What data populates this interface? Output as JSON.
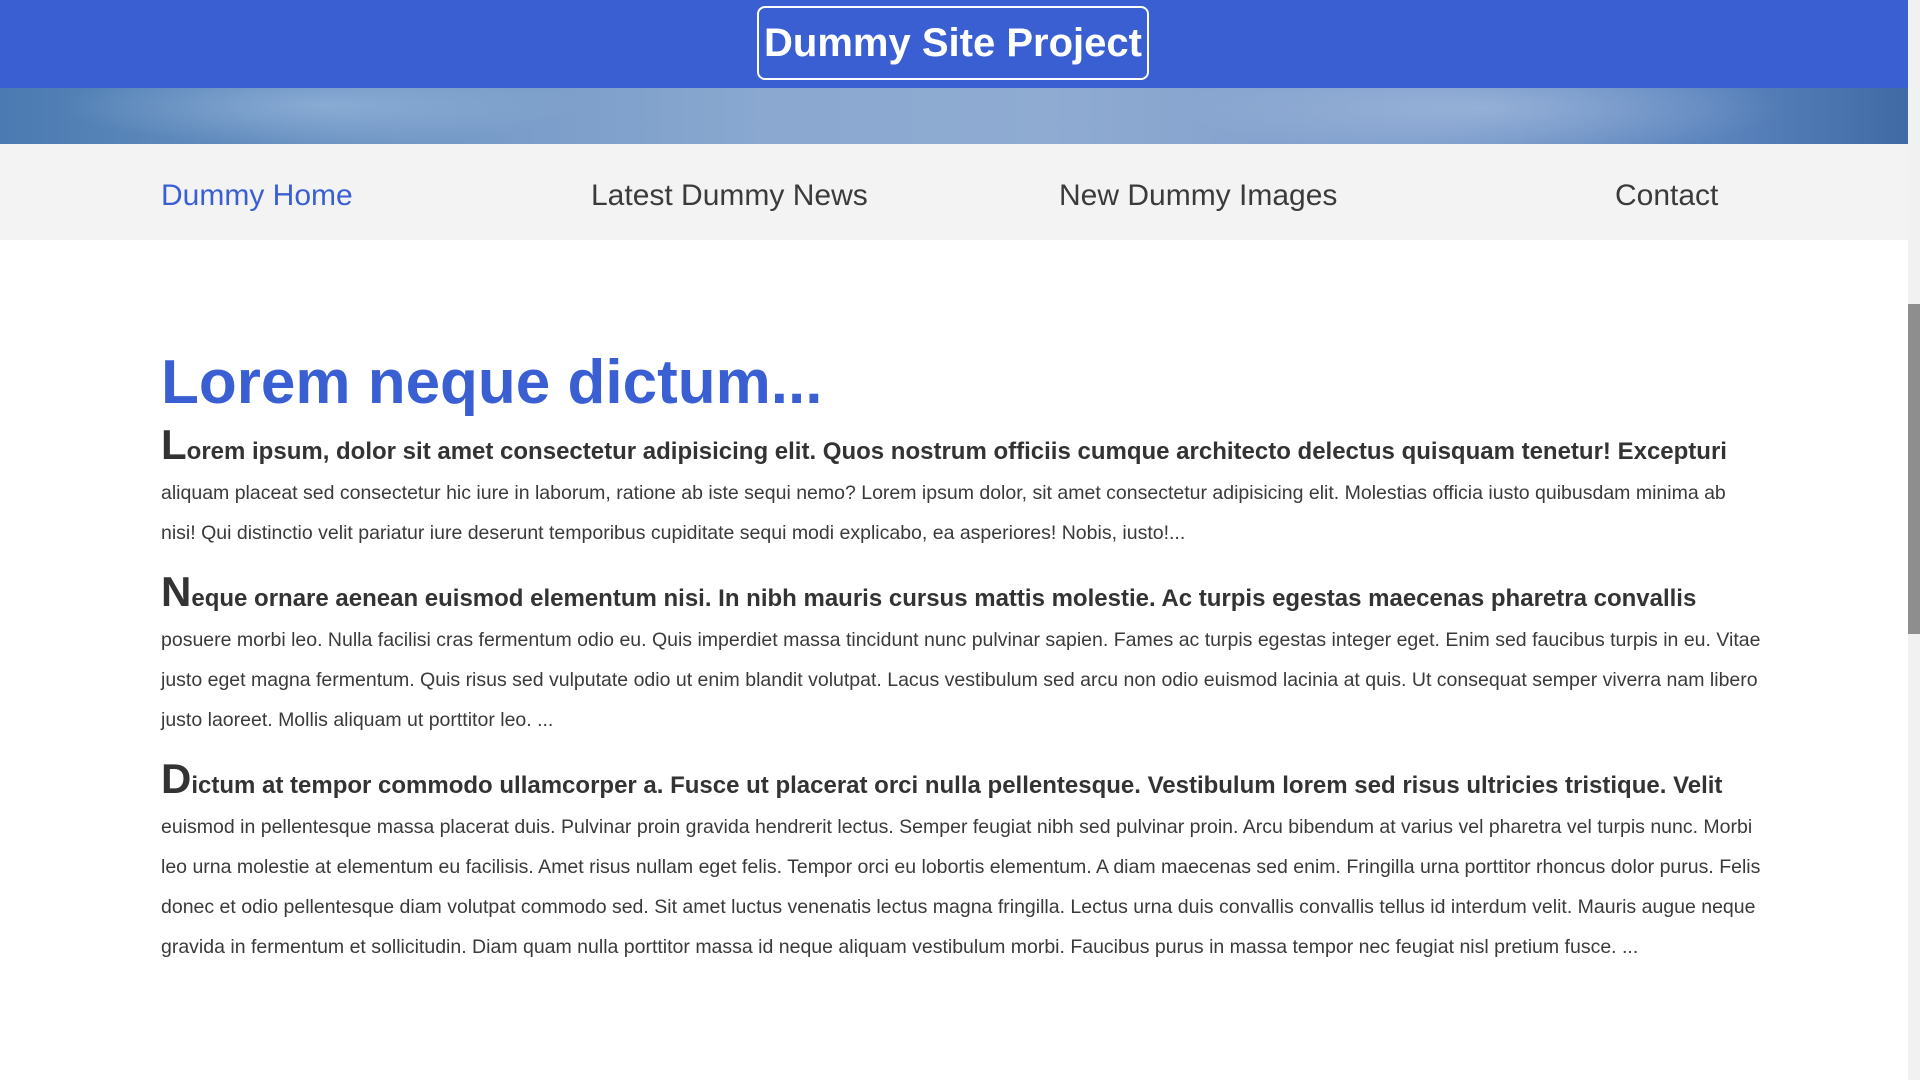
{
  "header": {
    "site_title": "Dummy Site Project"
  },
  "nav": {
    "items": [
      {
        "label": "Dummy Home",
        "active": true
      },
      {
        "label": "Latest Dummy News",
        "active": false
      },
      {
        "label": "New Dummy Images",
        "active": false
      },
      {
        "label": "Contact",
        "active": false
      }
    ]
  },
  "main": {
    "heading": "Lorem neque dictum...",
    "paragraphs": [
      {
        "dropcap": "L",
        "lead": "orem ipsum, dolor sit amet consectetur adipisicing elit. Quos nostrum officiis cumque architecto delectus quisquam tenetur! Excepturi",
        "body": "aliquam placeat sed consectetur hic iure in laborum, ratione ab iste sequi nemo? Lorem ipsum dolor, sit amet consectetur adipisicing elit. Molestias officia iusto quibusdam minima ab nisi! Qui distinctio velit pariatur iure deserunt temporibus cupiditate sequi modi explicabo, ea asperiores! Nobis, iusto!..."
      },
      {
        "dropcap": "N",
        "lead": "eque ornare aenean euismod elementum nisi. In nibh mauris cursus mattis molestie. Ac turpis egestas maecenas pharetra convallis",
        "body": "posuere morbi leo. Nulla facilisi cras fermentum odio eu. Quis imperdiet massa tincidunt nunc pulvinar sapien. Fames ac turpis egestas integer eget. Enim sed faucibus turpis in eu. Vitae justo eget magna fermentum. Quis risus sed vulputate odio ut enim blandit volutpat. Lacus vestibulum sed arcu non odio euismod lacinia at quis. Ut consequat semper viverra nam libero justo laoreet. Mollis aliquam ut porttitor leo. ..."
      },
      {
        "dropcap": "D",
        "lead": "ictum at tempor commodo ullamcorper a. Fusce ut placerat orci nulla pellentesque. Vestibulum lorem sed risus ultricies tristique. Velit",
        "body": "euismod in pellentesque massa placerat duis. Pulvinar proin gravida hendrerit lectus. Semper feugiat nibh sed pulvinar proin. Arcu bibendum at varius vel pharetra vel turpis nunc. Morbi leo urna molestie at elementum eu facilisis. Amet risus nullam eget felis. Tempor orci eu lobortis elementum. A diam maecenas sed enim. Fringilla urna porttitor rhoncus dolor purus. Felis donec et odio pellentesque diam volutpat commodo sed. Sit amet luctus venenatis lectus magna fringilla. Lectus urna duis convallis convallis tellus id interdum velit. Mauris augue neque gravida in fermentum et sollicitudin. Diam quam nulla porttitor massa id neque aliquam vestibulum morbi. Faucibus purus in massa tempor nec feugiat nisl pretium fusce. ..."
      }
    ]
  },
  "colors": {
    "accent": "#3a5fd3",
    "nav_background": "#f3f3f3",
    "text": "#3a3a3a"
  }
}
